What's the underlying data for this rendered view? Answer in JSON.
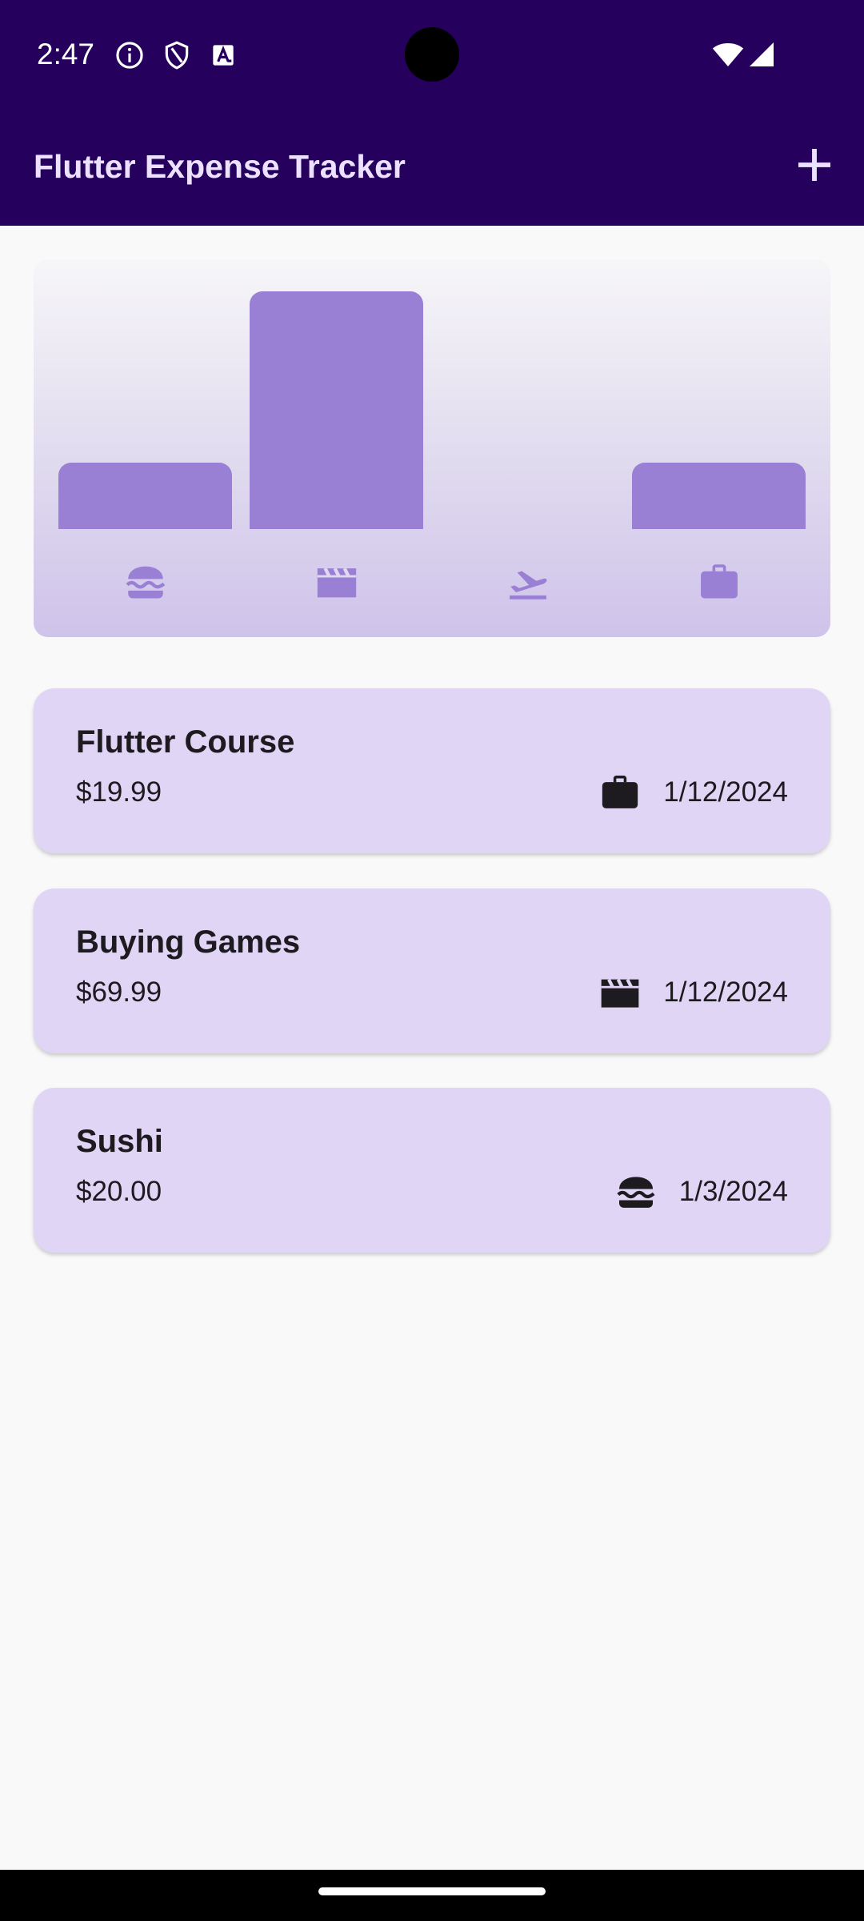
{
  "status_bar": {
    "time": "2:47",
    "icons": [
      "info-icon",
      "shield-icon",
      "keyboard-a-icon",
      "wifi-icon",
      "signal-icon"
    ]
  },
  "app_bar": {
    "title": "Flutter Expense Tracker",
    "action_icon": "add-icon"
  },
  "chart": {
    "type": "bar",
    "buckets": [
      {
        "category": "food",
        "icon": "burger-icon",
        "level": 0.28
      },
      {
        "category": "leisure",
        "icon": "clapperboard-icon",
        "level": 1.0
      },
      {
        "category": "travel",
        "icon": "flight-takeoff-icon",
        "level": 0.0
      },
      {
        "category": "work",
        "icon": "briefcase-icon",
        "level": 0.28
      }
    ],
    "bar_color": "#9980d4"
  },
  "expenses": [
    {
      "title": "Flutter Course",
      "amount": "$19.99",
      "category_icon": "briefcase-icon",
      "date": "1/12/2024"
    },
    {
      "title": "Buying Games",
      "amount": "$69.99",
      "category_icon": "clapperboard-icon",
      "date": "1/12/2024"
    },
    {
      "title": "Sushi",
      "amount": "$20.00",
      "category_icon": "burger-icon",
      "date": "1/3/2024"
    }
  ],
  "colors": {
    "app_bar": "#25005c",
    "card_background": "#e1d5f5",
    "page_background": "#f9f9f9",
    "title_text": "#ece2ff"
  }
}
